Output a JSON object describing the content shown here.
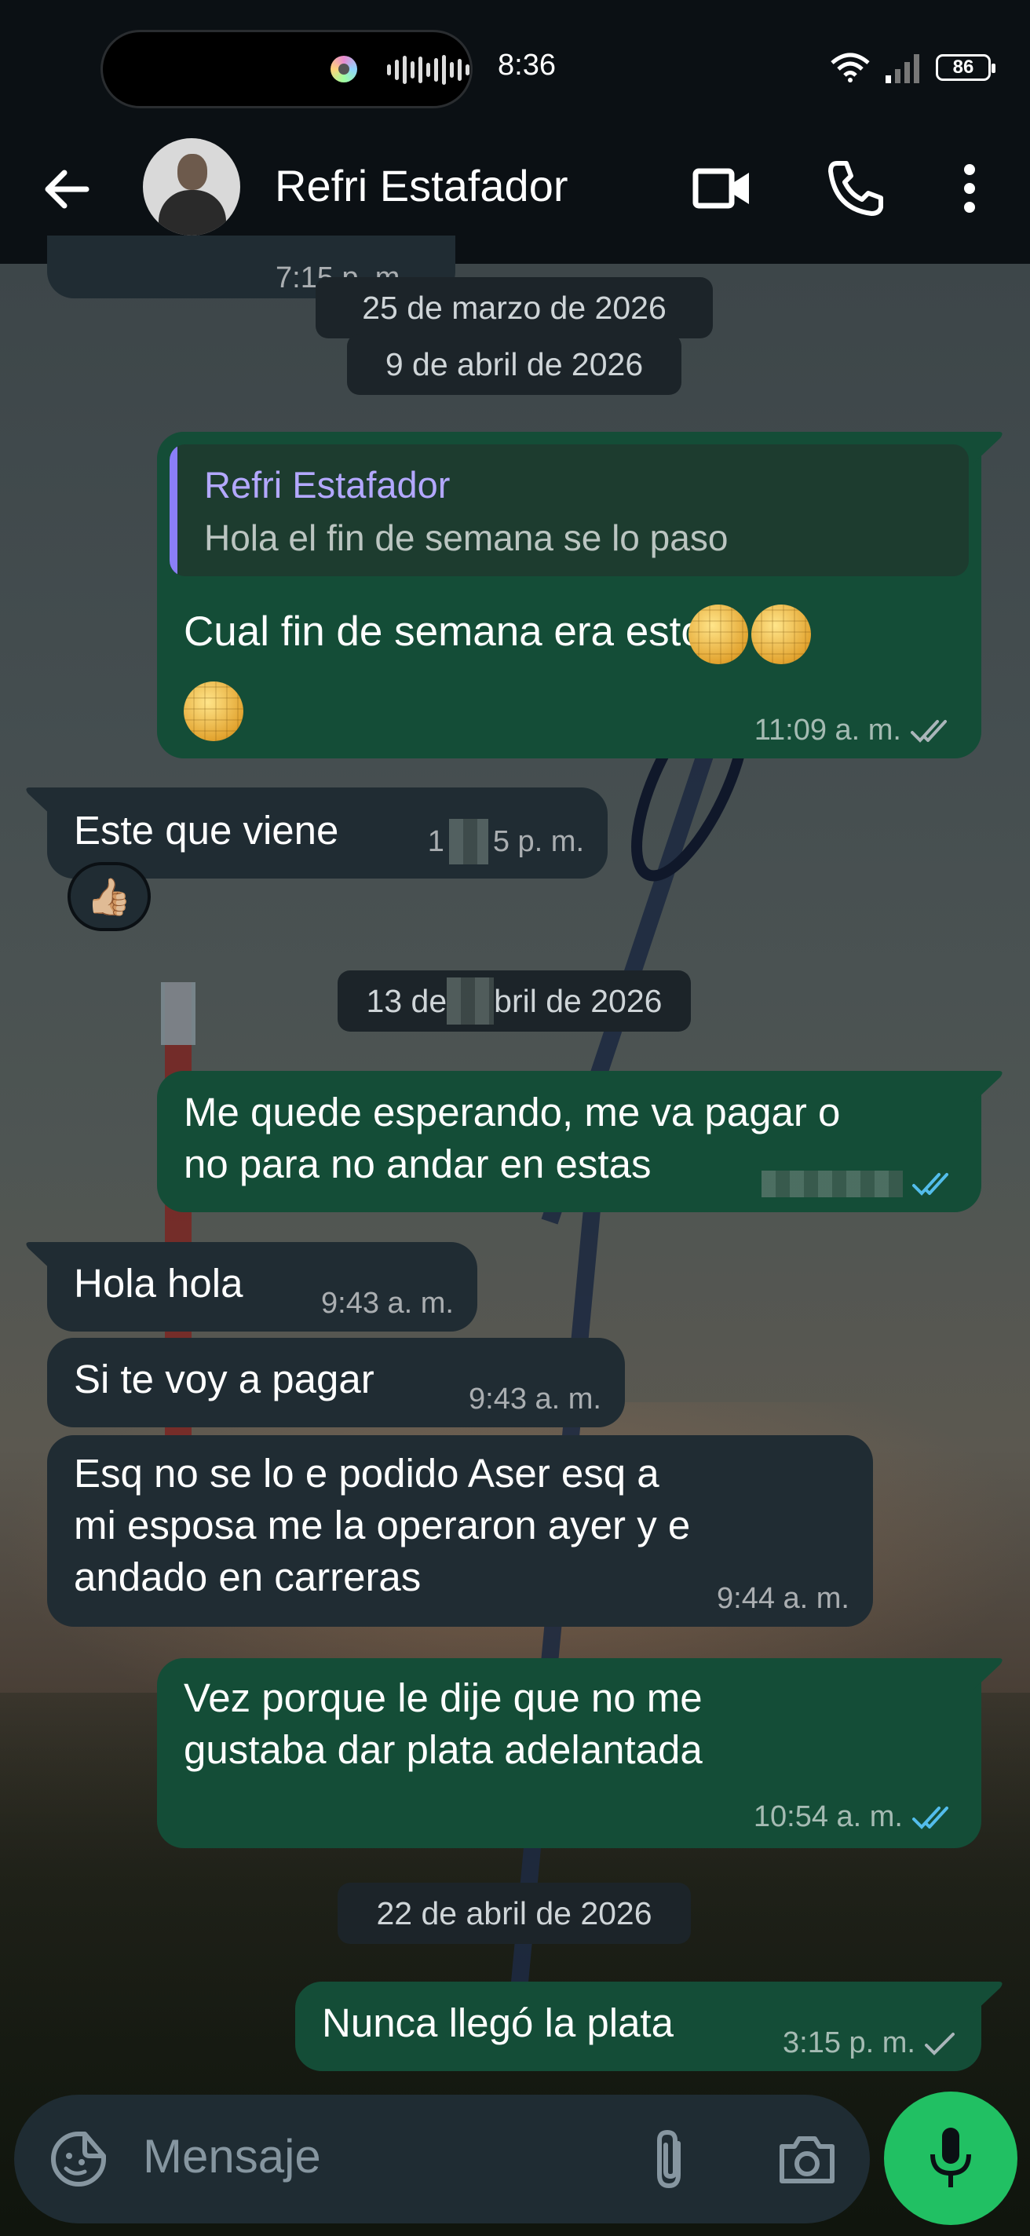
{
  "status_bar": {
    "time": "8:36",
    "battery": "86"
  },
  "header": {
    "contact_name": "Refri Estafador"
  },
  "messages": {
    "prev_partial_time": "7:15 p. m.",
    "date_1": "25 de marzo de 2026",
    "date_2": "9 de abril de 2026",
    "reply": {
      "quoted_name": "Refri Estafador",
      "quoted_text": "Hola el fin de semana se lo paso",
      "text": "Cual fin de semana era esto",
      "time": "11:09 a. m."
    },
    "este_que_viene": {
      "text": "Este que viene",
      "time_visible_start": "1",
      "time_visible_end": "5 p. m."
    },
    "reaction_emoji": "👍🏼",
    "date_3_start": "13 de",
    "date_3_end": "bril de 2026",
    "me_quede": {
      "text": "Me quede esperando, me va pagar o\nno para no andar en estas"
    },
    "hola": {
      "text": "Hola hola",
      "time": "9:43 a. m."
    },
    "si_te_voy": {
      "text": "Si te voy a pagar",
      "time": "9:43 a. m."
    },
    "esq": {
      "text": "Esq no se lo e podido Aser esq a\nmi esposa me la operaron ayer y e\nandado en carreras",
      "time": "9:44 a. m."
    },
    "vez": {
      "text": "Vez porque le dije que no me\ngustaba dar plata adelantada",
      "time": "10:54 a. m."
    },
    "date_4": "22 de abril de 2026",
    "nunca": {
      "text": "Nunca llegó la plata",
      "time": "3:15 p. m."
    }
  },
  "composer": {
    "placeholder": "Mensaje"
  },
  "colors": {
    "outgoing_bubble": "#144d37",
    "incoming_bubble": "#202c33",
    "read_ticks": "#53bdeb",
    "mic_button": "#21c063"
  }
}
